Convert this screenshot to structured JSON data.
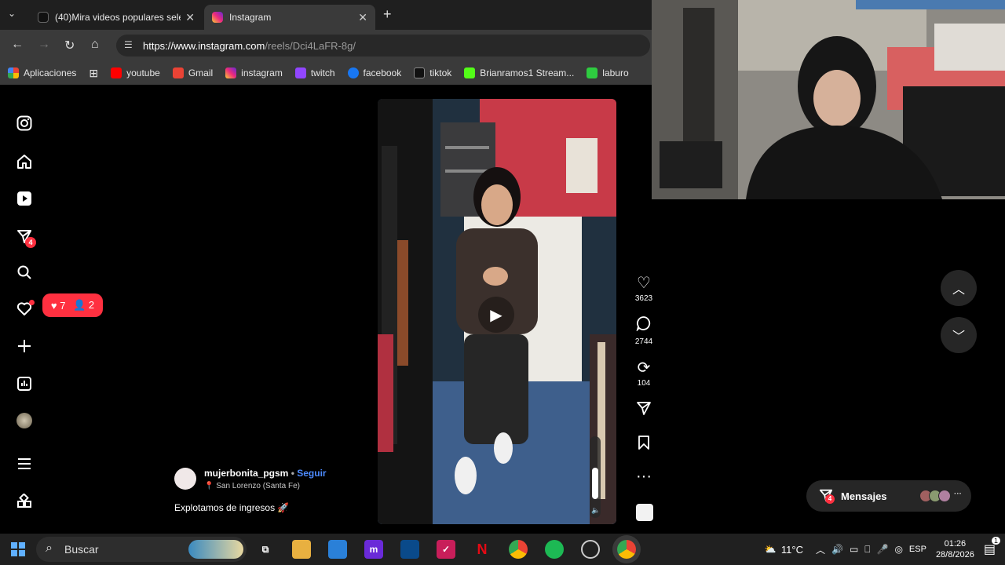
{
  "browser": {
    "tabs": [
      {
        "label": "(40)Mira videos populares selec",
        "active": false
      },
      {
        "label": "Instagram",
        "active": true
      }
    ],
    "url_host": "https://www.instagram.com",
    "url_path": "/reels/Dci4LaFR-8g/",
    "bookmarks": [
      {
        "label": "Aplicaciones",
        "color": "#e85a3c"
      },
      {
        "label": "youtube",
        "color": "#ff0000"
      },
      {
        "label": "Gmail",
        "color": "#ea4335"
      },
      {
        "label": "instagram",
        "color": "#d62976"
      },
      {
        "label": "twitch",
        "color": "#9146ff"
      },
      {
        "label": "facebook",
        "color": "#1877f2"
      },
      {
        "label": "tiktok",
        "color": "#111111"
      },
      {
        "label": "Brianramos1 Stream...",
        "color": "#53fc18"
      },
      {
        "label": "laburo",
        "color": "#2ecc40"
      }
    ]
  },
  "nav": {
    "direct_badge": "4",
    "notifications": {
      "likes": "7",
      "follows": "2"
    }
  },
  "reel": {
    "author": "mujerbonita_pgsm",
    "separator": " • ",
    "follow_label": "Seguir",
    "location": "San Lorenzo (Santa Fe)",
    "caption": "Explotamos de ingresos",
    "likes": "3623",
    "comments": "2744",
    "reposts": "104"
  },
  "messages": {
    "label": "Mensajes",
    "badge": "4"
  },
  "taskbar": {
    "search_placeholder": "Buscar",
    "weather": "11°C",
    "lang": "ESP",
    "time": "01:26",
    "date": "28/8/2026",
    "notif_count": "1"
  }
}
